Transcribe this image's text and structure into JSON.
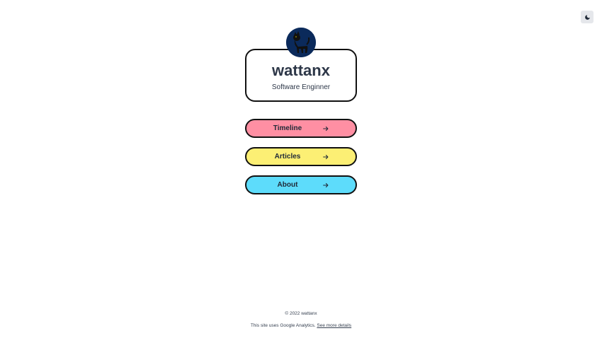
{
  "profile": {
    "name": "wattanx",
    "role": "Software Enginner"
  },
  "nav": [
    {
      "label": "Timeline",
      "color": "#ff8fa3"
    },
    {
      "label": "Articles",
      "color": "#fcef74"
    },
    {
      "label": "About",
      "color": "#5ddcfb"
    }
  ],
  "footer": {
    "copyright": "© 2022 wattanx",
    "analytics_text": "This site uses Google Analytics.",
    "analytics_link": "See more details"
  },
  "icons": {
    "theme_toggle": "moon-icon",
    "nav_arrow": "arrow-right-icon",
    "avatar": "black-cat-avatar"
  },
  "colors": {
    "avatar_bg": "#0b2a5b",
    "text": "#2d3748",
    "border": "#111111"
  }
}
